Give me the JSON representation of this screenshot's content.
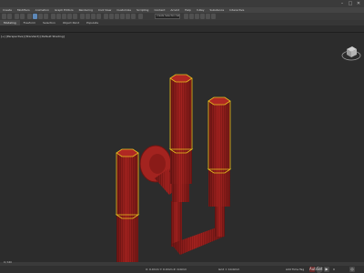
{
  "window": {
    "controls": {
      "minimize": "–",
      "maximize": "□",
      "close": "✕"
    }
  },
  "menu": {
    "items": [
      "Create",
      "Modifiers",
      "Animation",
      "Graph Editors",
      "Rendering",
      "Civil View",
      "Customize",
      "Scripting",
      "Content",
      "Arnold",
      "Help",
      "V-Ray",
      "Substance",
      "Interactive"
    ]
  },
  "toolbar": {
    "selection_set": "Create Selection Set"
  },
  "ribbon": {
    "tabs": [
      "Modeling",
      "Freeform",
      "Selection",
      "Object Paint",
      "Populate"
    ],
    "active": 0
  },
  "viewport": {
    "label": "[+] [Perspective] [Standard] [Default Shading]"
  },
  "timeline": {
    "range": "0 / 100"
  },
  "status": {
    "coords": "X: 0.0mm   Y: 0.0mm   Z: 0.0mm",
    "grid": "Grid = 10.0mm",
    "add_time_tag": "Add Time Tag",
    "frame": "0",
    "autokey": "Auto",
    "setkey": "Set K."
  },
  "colors": {
    "accent": "#5d88b8",
    "object": "#a82320",
    "selection": "#e5c31c"
  }
}
